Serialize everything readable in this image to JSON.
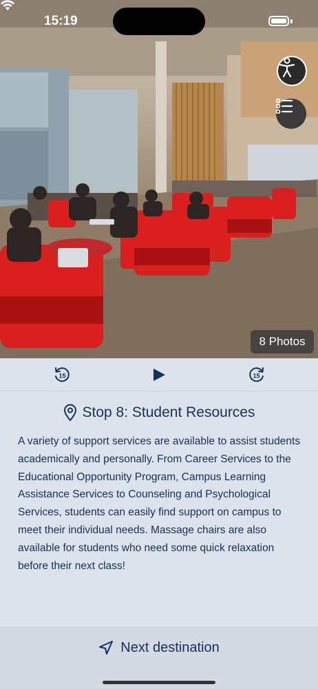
{
  "status": {
    "time": "15:19"
  },
  "photo": {
    "count_label": "8 Photos"
  },
  "header_buttons": {
    "accessibility": "accessibility-icon",
    "list": "list-icon"
  },
  "player": {
    "rewind_seconds": "15",
    "forward_seconds": "15"
  },
  "stop": {
    "title": "Stop 8: Student Resources",
    "description": "A variety of support services are available to assist students academically and personally. From Career Services to the Educational Opportunity Program, Campus Learning Assistance Services to Counseling and Psychological Services, students can easily find support on campus to meet their individual needs. Massage chairs are also available for students who need some quick relaxation before their next class!"
  },
  "navigation": {
    "next_label": "Next destination"
  },
  "colors": {
    "text": "#13315c",
    "background": "#dde3ea",
    "chair_red": "#d9201f"
  }
}
